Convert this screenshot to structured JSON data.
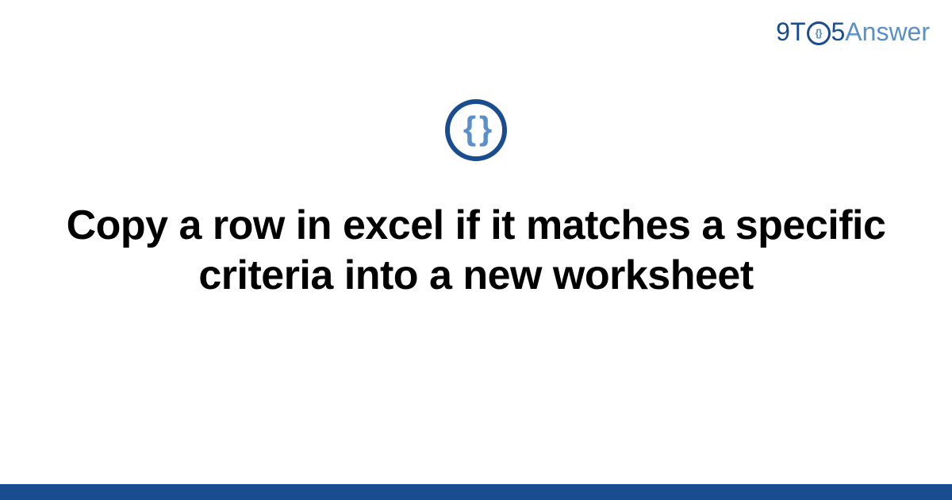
{
  "logo": {
    "part1": "9T",
    "circle_inner": "{}",
    "part2": "5",
    "part3": "Answer"
  },
  "center_icon": "{ }",
  "title": "Copy a row in excel if it matches a specific criteria into a new worksheet",
  "colors": {
    "primary": "#1a4d8f",
    "secondary": "#5a8fc7"
  }
}
